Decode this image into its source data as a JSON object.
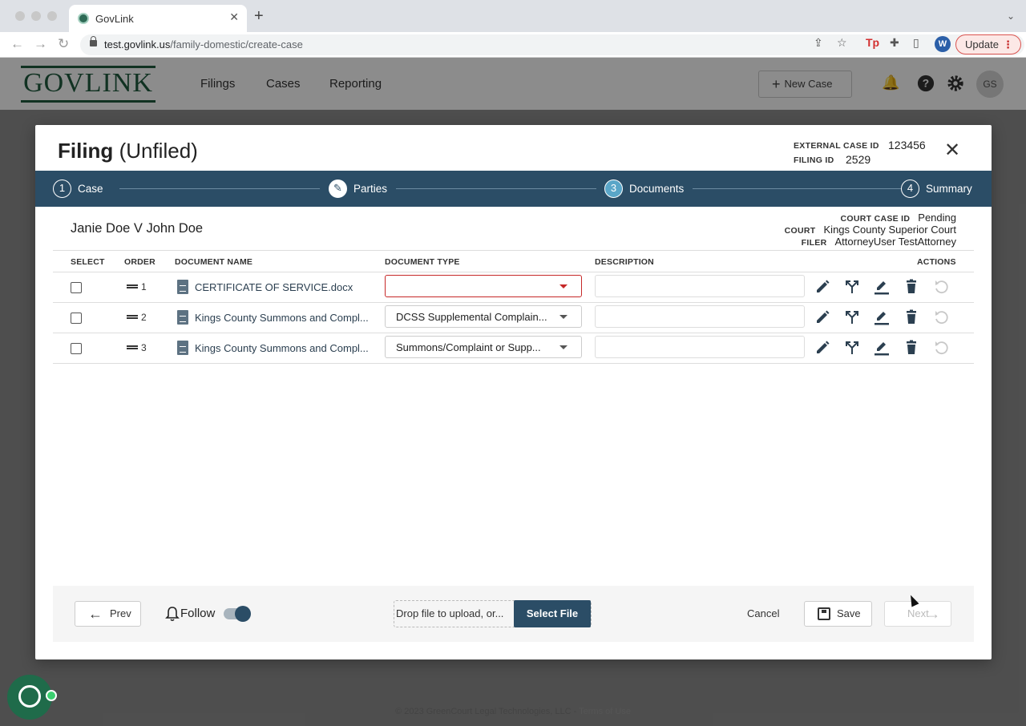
{
  "browser": {
    "tab_title": "GovLink",
    "tab_close": "✕",
    "new_tab": "+",
    "url_host": "test.govlink.us",
    "url_path": "/family-domestic/create-case",
    "profile_initial": "W",
    "update_label": "Update",
    "update_menu": "⋮",
    "ext_tp": "Tp"
  },
  "app": {
    "logo": "GOVLINK",
    "nav": [
      "Filings",
      "Cases",
      "Reporting"
    ],
    "new_case_label": "New Case",
    "avatar_initials": "GS"
  },
  "modal": {
    "title_bold": "Filing",
    "title_status": "(Unfiled)",
    "external_case_id_label": "EXTERNAL CASE ID",
    "external_case_id": "123456",
    "filing_id_label": "FILING ID",
    "filing_id": "2529",
    "close": "✕",
    "steps": [
      {
        "num": "1",
        "label": "Case",
        "state": "default"
      },
      {
        "num": "✎",
        "label": "Parties",
        "state": "done"
      },
      {
        "num": "3",
        "label": "Documents",
        "state": "active"
      },
      {
        "num": "4",
        "label": "Summary",
        "state": "default"
      }
    ],
    "case_name": "Janie Doe V John Doe",
    "case_info": [
      {
        "label": "COURT CASE ID",
        "value": "Pending"
      },
      {
        "label": "COURT",
        "value": "Kings County Superior Court"
      },
      {
        "label": "FILER",
        "value": "AttorneyUser TestAttorney"
      }
    ],
    "table": {
      "headers": {
        "select": "SELECT",
        "order": "ORDER",
        "document_name": "DOCUMENT NAME",
        "document_type": "DOCUMENT TYPE",
        "description": "DESCRIPTION",
        "actions": "ACTIONS"
      },
      "rows": [
        {
          "order": "1",
          "name": "CERTIFICATE OF SERVICE.docx",
          "type": "",
          "description": "",
          "error": true
        },
        {
          "order": "2",
          "name": "Kings County Summons and Compl...",
          "type": "DCSS Supplemental Complain...",
          "description": "",
          "error": false
        },
        {
          "order": "3",
          "name": "Kings County Summons and Compl...",
          "type": "Summons/Complaint or Supp...",
          "description": "",
          "error": false
        }
      ]
    },
    "footer": {
      "prev_label": "Prev",
      "follow_label": "Follow",
      "follow_enabled": true,
      "drop_text": "Drop file to upload, or...",
      "select_file_label": "Select File",
      "cancel_label": "Cancel",
      "save_label": "Save",
      "next_label": "Next"
    }
  },
  "page_footer": {
    "copyright": "© 2023 GreenCourt Legal Technologies, LLC - ",
    "terms": "Terms of Use"
  },
  "colors": {
    "stepper_bg": "#2b4d66",
    "brand_green": "#1f5b3f",
    "error_red": "#c62828"
  }
}
